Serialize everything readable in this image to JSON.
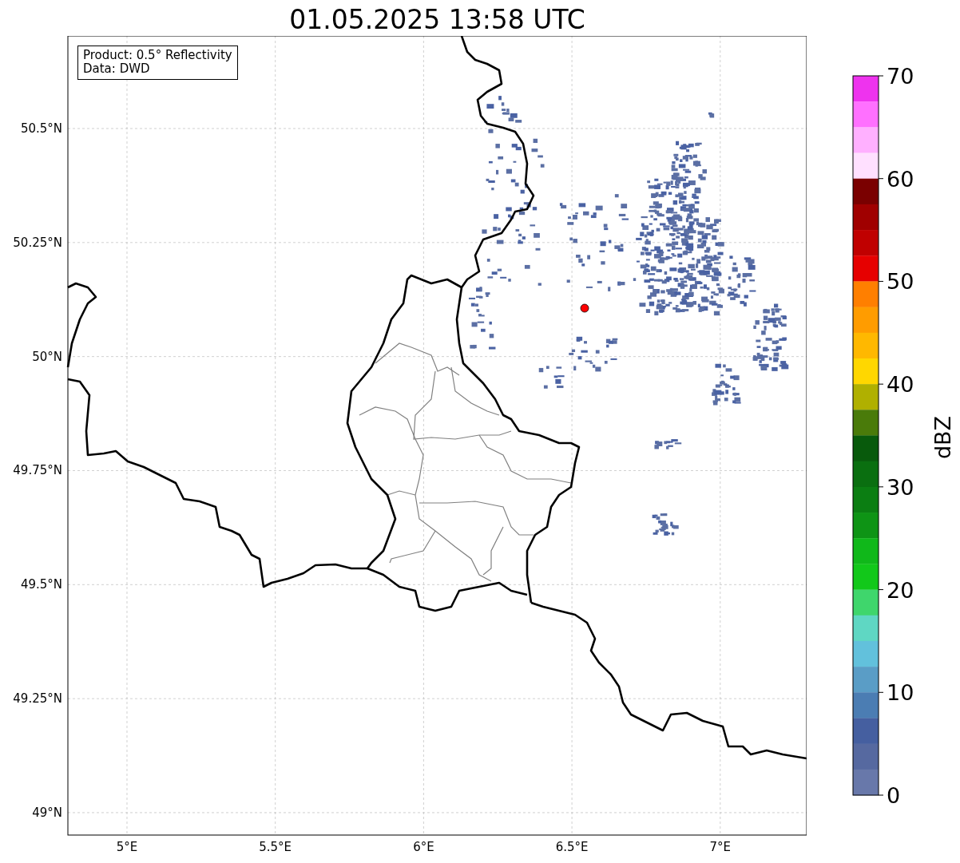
{
  "title": "01.05.2025 13:58 UTC",
  "info_box": {
    "lines": [
      "Product: 0.5° Reflectivity",
      "Data: DWD"
    ]
  },
  "map": {
    "lat_ticks": [
      "50.5°N",
      "50.25°N",
      "50°N",
      "49.75°N",
      "49.5°N",
      "49.25°N",
      "49°N"
    ],
    "lon_ticks": [
      "5°E",
      "5.5°E",
      "6°E",
      "6.5°E",
      "7°E"
    ]
  },
  "colorbar": {
    "label": "dBZ",
    "ticks": [
      "70",
      "60",
      "50",
      "40",
      "30",
      "20",
      "10",
      "0"
    ],
    "bands": [
      {
        "color": "#ee33ee"
      },
      {
        "color": "#ff70ff"
      },
      {
        "color": "#ffb0ff"
      },
      {
        "color": "#ffe0ff"
      },
      {
        "color": "#7a0000"
      },
      {
        "color": "#a00000"
      },
      {
        "color": "#c00000"
      },
      {
        "color": "#e60000"
      },
      {
        "color": "#ff7f00"
      },
      {
        "color": "#ff9c00"
      },
      {
        "color": "#ffb800"
      },
      {
        "color": "#ffd700"
      },
      {
        "color": "#b0b000"
      },
      {
        "color": "#4a7b0a"
      },
      {
        "color": "#085a0c"
      },
      {
        "color": "#0a6f10"
      },
      {
        "color": "#0b7e12"
      },
      {
        "color": "#0e9415"
      },
      {
        "color": "#10b81a"
      },
      {
        "color": "#12c81a"
      },
      {
        "color": "#3fd66c"
      },
      {
        "color": "#5fd7c3"
      },
      {
        "color": "#62c1dc"
      },
      {
        "color": "#5a9dc6"
      },
      {
        "color": "#4b7db3"
      },
      {
        "color": "#455fa0"
      },
      {
        "color": "#5669a0"
      },
      {
        "color": "#6878aa"
      }
    ]
  }
}
